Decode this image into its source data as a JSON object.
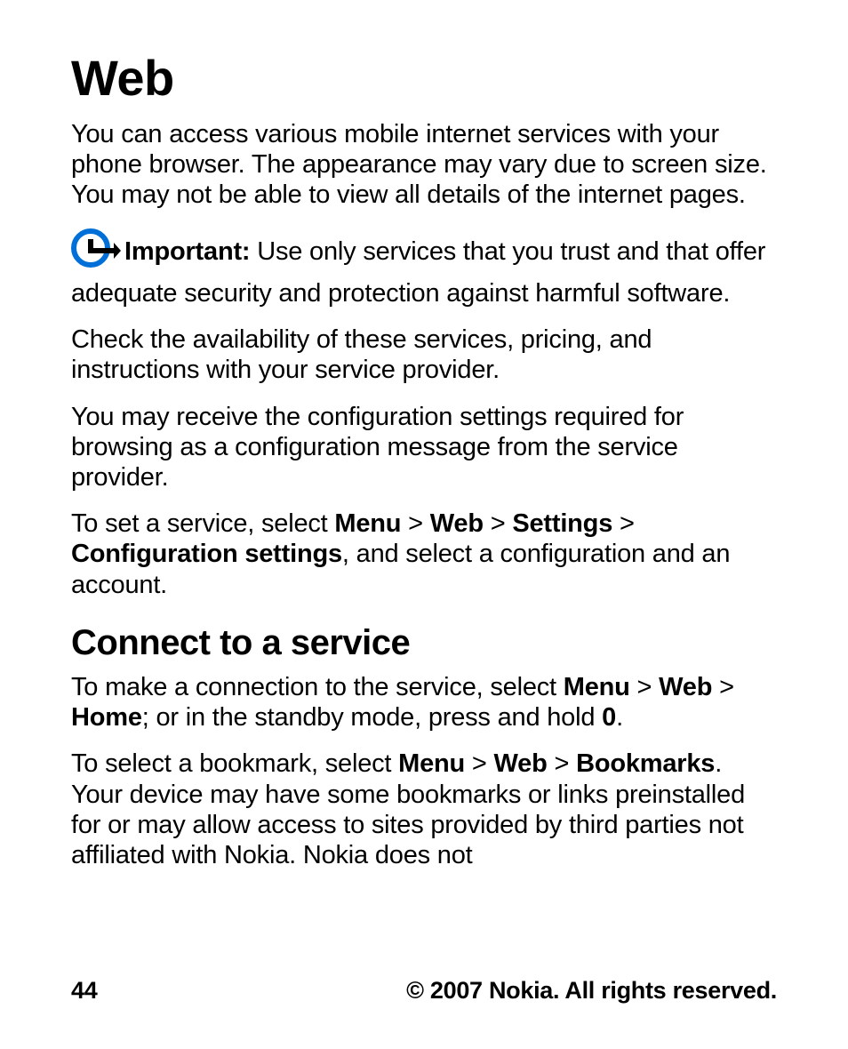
{
  "title": "Web",
  "p1": "You can access various mobile internet services with your phone browser. The appearance may vary due to screen size. You may not be able to view all details of the internet pages.",
  "important_label": "Important:",
  "important_text": " Use only services that you trust and that offer adequate security and protection against harmful software.",
  "p2": "Check the availability of these services, pricing, and instructions with your service provider.",
  "p3": "You may receive the configuration settings required for browsing as a configuration message from the service provider.",
  "p4a": "To set a service, select ",
  "p4_menu": "Menu",
  "sep": " > ",
  "p4_web": "Web",
  "p4_settings": "Settings",
  "p4_config": "Configuration settings",
  "p4b": ", and select a configuration and an account.",
  "h2": "Connect to a service",
  "p5a": "To make a connection to the service, select ",
  "p5_menu": "Menu",
  "p5_web": "Web",
  "p5_home": "Home",
  "p5b": "; or in the standby mode, press and hold ",
  "p5_zero": "0",
  "p5c": ".",
  "p6a": "To select a bookmark, select ",
  "p6_menu": "Menu",
  "p6_web": "Web",
  "p6_bookmarks": "Bookmarks",
  "p6b": ". Your device may have some bookmarks or links preinstalled for or may allow access to sites provided by third parties not affiliated with Nokia. Nokia does not",
  "page_number": "44",
  "copyright": "© 2007 Nokia. All rights reserved."
}
